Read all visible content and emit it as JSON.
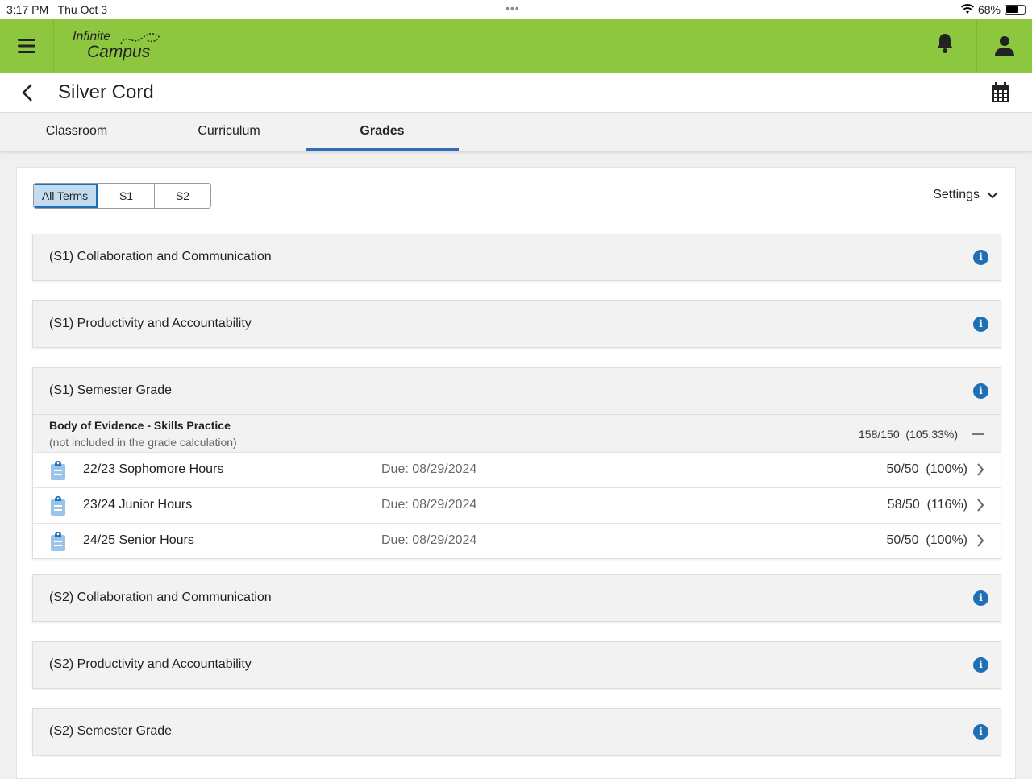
{
  "status": {
    "time": "3:17 PM",
    "date": "Thu Oct 3",
    "battery": "68%",
    "battery_level": 0.68
  },
  "header": {
    "logo_line1": "Infinite",
    "logo_line2": "Campus",
    "brand_color": "#8dc63f"
  },
  "page": {
    "title": "Silver Cord"
  },
  "tabs": [
    {
      "label": "Classroom"
    },
    {
      "label": "Curriculum"
    },
    {
      "label": "Grades",
      "active": true
    }
  ],
  "terms": [
    {
      "label": "All Terms",
      "selected": true
    },
    {
      "label": "S1"
    },
    {
      "label": "S2"
    }
  ],
  "settings_label": "Settings",
  "sections": [
    {
      "title": "(S1) Collaboration and Communication"
    },
    {
      "title": "(S1) Productivity and Accountability"
    },
    {
      "title": "(S1) Semester Grade",
      "group": {
        "name": "Body of Evidence - Skills Practice",
        "note": "(not included in the grade calculation)",
        "score": "158/150",
        "percent": "(105.33%)",
        "assignments": [
          {
            "name": "22/23 Sophomore Hours",
            "due": "Due: 08/29/2024",
            "score": "50/50",
            "percent": "(100%)"
          },
          {
            "name": "23/24 Junior Hours",
            "due": "Due: 08/29/2024",
            "score": "58/50",
            "percent": "(116%)"
          },
          {
            "name": "24/25 Senior Hours",
            "due": "Due: 08/29/2024",
            "score": "50/50",
            "percent": "(100%)"
          }
        ]
      }
    },
    {
      "title": "(S2) Collaboration and Communication"
    },
    {
      "title": "(S2) Productivity and Accountability"
    },
    {
      "title": "(S2) Semester Grade"
    }
  ]
}
